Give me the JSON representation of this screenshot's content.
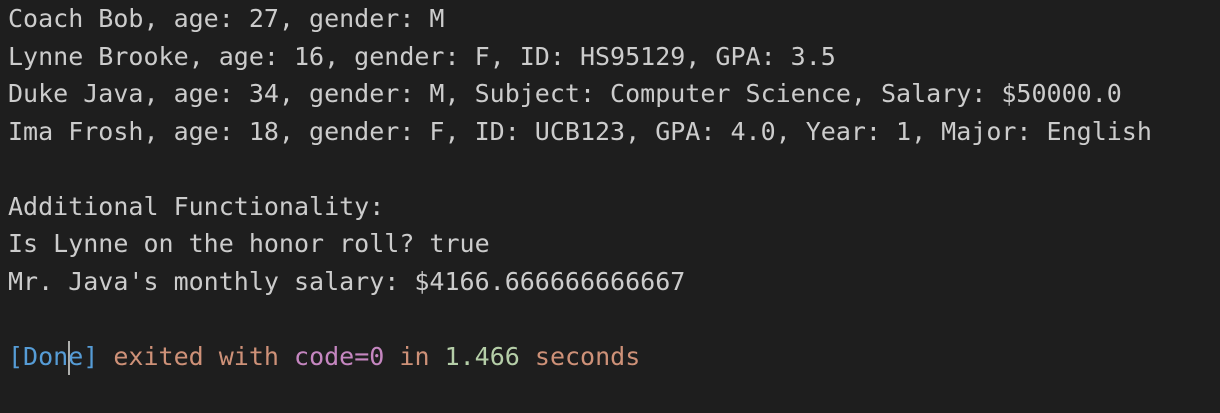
{
  "output": {
    "lines": [
      "Coach Bob, age: 27, gender: M",
      "Lynne Brooke, age: 16, gender: F, ID: HS95129, GPA: 3.5",
      "Duke Java, age: 34, gender: M, Subject: Computer Science, Salary: $50000.0",
      "Ima Frosh, age: 18, gender: F, ID: UCB123, GPA: 4.0, Year: 1, Major: English",
      "",
      "Additional Functionality:",
      "Is Lynne on the honor roll? true",
      "Mr. Java's monthly salary: $4166.666666666667"
    ]
  },
  "status": {
    "tag": "[Done]",
    "exited_with": "exited with",
    "code": "code=0",
    "in": "in",
    "duration": "1.466",
    "unit": "seconds"
  },
  "colors": {
    "background": "#1e1e1e",
    "text": "#cccccc",
    "done_tag": "#569cd6",
    "done_words": "#ce9178",
    "exit_code": "#c586c0",
    "duration": "#b5cea8"
  }
}
